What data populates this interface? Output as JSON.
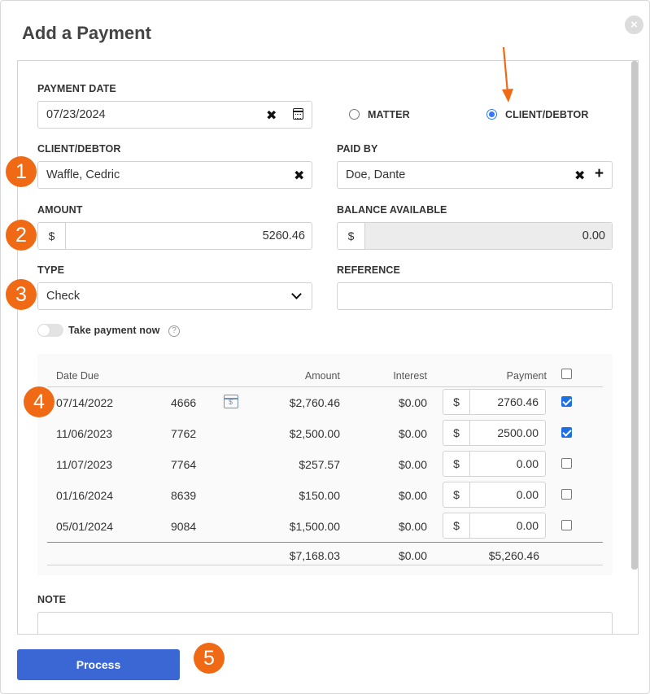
{
  "title": "Add a Payment",
  "close_icon": "×",
  "form": {
    "payment_date": {
      "label": "PAYMENT DATE",
      "value": "07/23/2024",
      "clear": "✖"
    },
    "matter_option": {
      "label": "MATTER",
      "selected": false
    },
    "client_option": {
      "label": "CLIENT/DEBTOR",
      "selected": true
    },
    "client_debtor": {
      "label": "CLIENT/DEBTOR",
      "value": "Waffle, Cedric",
      "clear": "✖"
    },
    "paid_by": {
      "label": "PAID BY",
      "value": "Doe, Dante",
      "clear": "✖",
      "add": "+"
    },
    "amount": {
      "label": "AMOUNT",
      "currency": "$",
      "value": "5260.46"
    },
    "balance_available": {
      "label": "BALANCE AVAILABLE",
      "currency": "$",
      "value": "0.00"
    },
    "type": {
      "label": "TYPE",
      "value": "Check"
    },
    "reference": {
      "label": "REFERENCE",
      "value": ""
    },
    "take_payment_now": {
      "label": "Take payment now",
      "help": "?",
      "on": false
    },
    "note": {
      "label": "NOTE",
      "value": ""
    }
  },
  "table": {
    "headers": {
      "date_due": "Date Due",
      "amount": "Amount",
      "interest": "Interest",
      "payment": "Payment"
    },
    "currency": "$",
    "calendar_icon_glyph": "$",
    "rows": [
      {
        "date": "07/14/2022",
        "number": "4666",
        "amount": "$2,760.46",
        "interest": "$0.00",
        "payment": "2760.46",
        "checked": true,
        "icon": "calendar-dollar-icon"
      },
      {
        "date": "11/06/2023",
        "number": "7762",
        "amount": "$2,500.00",
        "interest": "$0.00",
        "payment": "2500.00",
        "checked": true
      },
      {
        "date": "11/07/2023",
        "number": "7764",
        "amount": "$257.57",
        "interest": "$0.00",
        "payment": "0.00",
        "checked": false
      },
      {
        "date": "01/16/2024",
        "number": "8639",
        "amount": "$150.00",
        "interest": "$0.00",
        "payment": "0.00",
        "checked": false
      },
      {
        "date": "05/01/2024",
        "number": "9084",
        "amount": "$1,500.00",
        "interest": "$0.00",
        "payment": "0.00",
        "checked": false
      }
    ],
    "totals": {
      "amount": "$7,168.03",
      "interest": "$0.00",
      "payment": "$5,260.46"
    }
  },
  "badges": [
    "1",
    "2",
    "3",
    "4",
    "5"
  ],
  "process_label": "Process",
  "colors": {
    "accent": "#3a67d4",
    "badge": "#f06a16",
    "radio": "#3478f6",
    "checkbox": "#1f6fe0"
  }
}
